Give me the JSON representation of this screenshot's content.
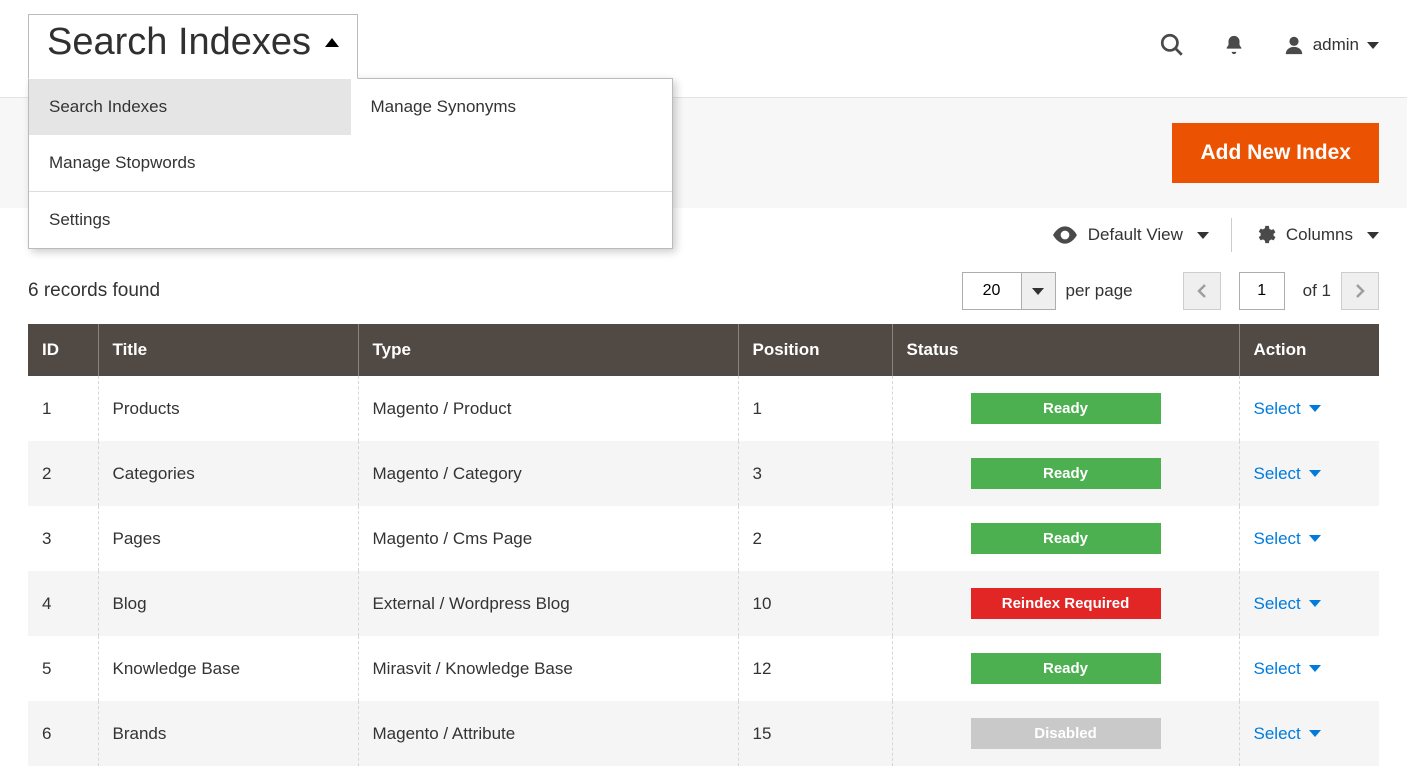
{
  "page": {
    "title": "Search Indexes"
  },
  "dropdown": {
    "items": [
      {
        "label": "Search Indexes",
        "active": true
      },
      {
        "label": "Manage Synonyms",
        "active": false
      },
      {
        "label": "Manage Stopwords",
        "active": false
      }
    ],
    "settings_label": "Settings"
  },
  "user": {
    "name": "admin"
  },
  "primary_action": {
    "label": "Add New Index"
  },
  "toolbar": {
    "view_label": "Default View",
    "columns_label": "Columns"
  },
  "pager": {
    "records_text": "6 records found",
    "page_size": "20",
    "per_page_label": "per page",
    "current_page": "1",
    "total_pages": "of 1"
  },
  "table": {
    "headers": {
      "id": "ID",
      "title": "Title",
      "type": "Type",
      "position": "Position",
      "status": "Status",
      "action": "Action"
    },
    "action_label": "Select",
    "rows": [
      {
        "id": "1",
        "title": "Products",
        "type": "Magento / Product",
        "position": "1",
        "status": "Ready",
        "status_class": "status-ready"
      },
      {
        "id": "2",
        "title": "Categories",
        "type": "Magento / Category",
        "position": "3",
        "status": "Ready",
        "status_class": "status-ready"
      },
      {
        "id": "3",
        "title": "Pages",
        "type": "Magento / Cms Page",
        "position": "2",
        "status": "Ready",
        "status_class": "status-ready"
      },
      {
        "id": "4",
        "title": "Blog",
        "type": "External / Wordpress Blog",
        "position": "10",
        "status": "Reindex Required",
        "status_class": "status-reindex"
      },
      {
        "id": "5",
        "title": "Knowledge Base",
        "type": "Mirasvit / Knowledge Base",
        "position": "12",
        "status": "Ready",
        "status_class": "status-ready"
      },
      {
        "id": "6",
        "title": "Brands",
        "type": "Magento / Attribute",
        "position": "15",
        "status": "Disabled",
        "status_class": "status-disabled"
      }
    ]
  }
}
